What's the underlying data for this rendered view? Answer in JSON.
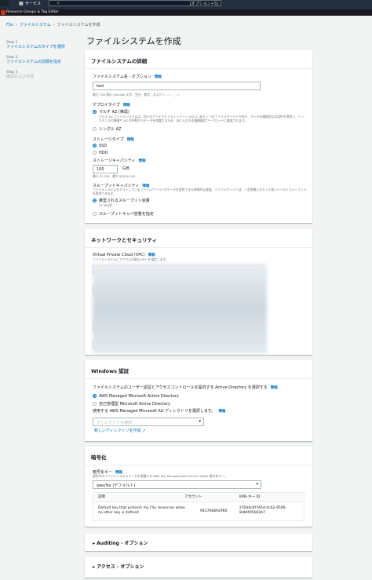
{
  "topbar": {
    "services": "サービス",
    "search_icon": "search-icon",
    "search_placeholder": "[オプション+S]",
    "resource_groups": "Resource Groups & Tag Editor"
  },
  "breadcrumb": [
    "FSx",
    "ファイルシステム",
    "ファイルシステムを作成"
  ],
  "steps": [
    {
      "num": "Step 1",
      "label": "ファイルシステムのタイプを選択",
      "current": false
    },
    {
      "num": "Step 2",
      "label": "ファイルシステムの詳細を指定",
      "current": false
    },
    {
      "num": "Step 3",
      "label": "確認および作成",
      "current": true
    }
  ],
  "page_title": "ファイルシステムを作成",
  "details": {
    "header": "ファイルシステムの詳細",
    "name_label": "ファイルシステム名 - オプション",
    "info": "情報",
    "name_value": "test",
    "name_hint": "最大 256 個の Unicode 文字、空白、数字、および + - = . _ : /",
    "deploy_label": "デプロイタイプ",
    "multi_az": "マルチ AZ (推奨)",
    "multi_az_desc": "マルチ AZ ファイルシステムは、別々のアベイラビリティーゾーン (AZ) にある 2 つのファイルサーバーがあり、データの継続的な可用性を提供し、インスタンスの障害や AZ の中断からデータを保護するため、ほとんどの本番稼働用ワークロードに推奨されます。",
    "single_az": "シングル AZ",
    "storage_type_label": "ストレージタイプ",
    "ssd": "SSD",
    "hdd": "HDD",
    "capacity_label": "ストレージキャパシティ",
    "capacity_value": "100",
    "capacity_unit": "GiB",
    "capacity_hint": "最小 32 GiB、最大 65536 GiB",
    "throughput_label": "スループットキャパシティ",
    "throughput_desc": "ファイルシステムをホストしているファイルサーバーがデータを提供できる持続的な速度。ファイルサーバーは、一定期間にわたって高いバーストスループットを提供できます。",
    "recommended": "推奨されるスループット容量",
    "recommended_sub": "32 MB/秒",
    "specify": "スループットキャパ容量を指定"
  },
  "network": {
    "header": "ネットワークとセキュリティ",
    "vpc_label": "Virtual Private Cloud (VPC)",
    "info": "情報",
    "vpc_desc": "ファイルシステムにアクセス可能な VPC を指定します。"
  },
  "windows": {
    "header": "Windows 認証",
    "desc": "ファイルシステムのユーザー認証とアクセスコントロールを提供する Active Directory を選択する",
    "info": "情報",
    "opt1": "AWS Managed Microsoft Active Directory",
    "opt2": "自己管理型 Microsoft Active Directory",
    "choose": "使用する AWS Managed Microsoft AD ディレクトリを選択します。",
    "placeholder": "ディレクトリを選択",
    "new_link": "新しいディレクトリを作成"
  },
  "encryption": {
    "header": "暗号化",
    "key_label": "暗号化キー",
    "info": "情報",
    "key_desc": "使用中のファイルシステムデータを保護する AWS Key Management Service (KMS) 暗号化キー。",
    "key_value": "aws/fsx (デフォルト)",
    "cols": [
      "説明",
      "アカウント",
      "KMS キー ID"
    ],
    "row": [
      "Default key that protects my FSx resources when no other key is defined",
      "942766892960",
      "250ddc6f-f44d-4cb2-9506-8dbf405b62b7"
    ]
  },
  "auditing": "Auditing - オプション",
  "access": "アクセス - オプション"
}
